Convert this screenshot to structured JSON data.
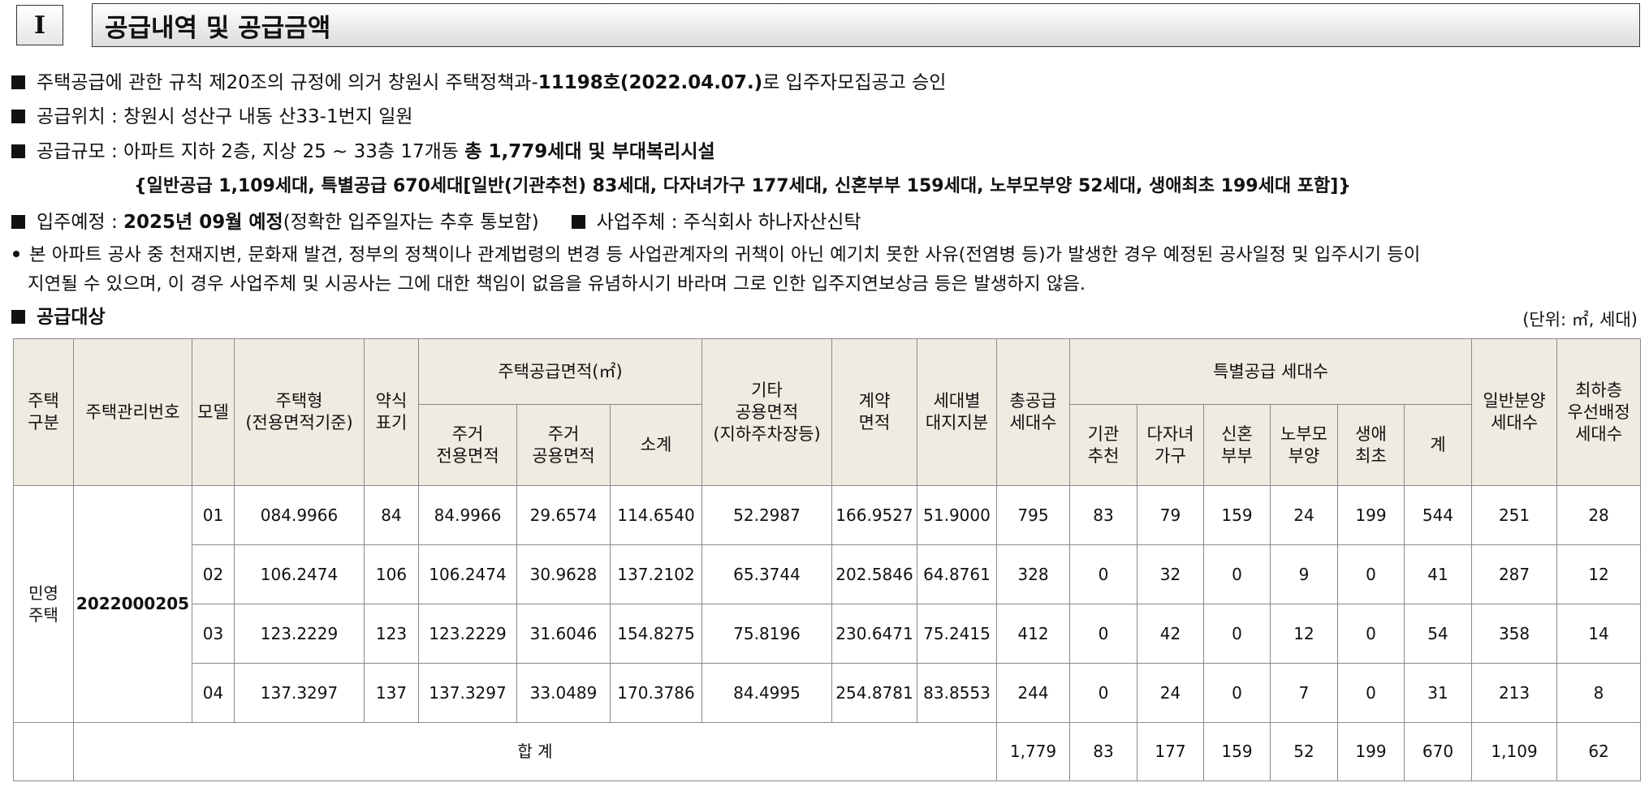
{
  "section": {
    "number": "I",
    "title": "공급내역 및 공급금액"
  },
  "notices": {
    "line1_a": "주택공급에 관한 규칙 제20조의 규정에 의거 창원시 주택정책과-",
    "line1_b": "11198호(2022.04.07.)",
    "line1_c": "로 입주자모집공고 승인",
    "line2": "공급위치 : 창원시 성산구 내동 산33-1번지 일원",
    "line3_a": "공급규모 : 아파트 지하 2층, 지상 25 ~ 33층 17개동 ",
    "line3_b": "총 1,779세대 및 부대복리시설",
    "line4": "{일반공급 1,109세대, 특별공급 670세대[일반(기관추천) 83세대, 다자녀가구 177세대, 신혼부부 159세대, 노부모부양 52세대, 생애최초 199세대 포함]}",
    "line5_a": "입주예정 : ",
    "line5_b": "2025년 09월 예정",
    "line5_c": "(정확한 입주일자는 추후 통보함)",
    "line5_d": "사업주체 : 주식회사 하나자산신탁",
    "line6": "본 아파트 공사 중 천재지변, 문화재 발견, 정부의 정책이나 관계법령의 변경 등 사업관계자의 귀책이 아닌 예기치 못한 사유(전염병 등)가 발생한 경우 예정된 공사일정 및 입주시기 등이",
    "line7": "지연될 수 있으며, 이 경우 사업주체 및 시공사는 그에 대한 책임이 없음을 유념하시기 바라며 그로 인한 입주지연보상금 등은 발생하지 않음."
  },
  "subsection": {
    "title": "공급대상",
    "unit": "(단위: ㎡, 세대)"
  },
  "table": {
    "headers": {
      "housing_type": "주택\n구분",
      "mgmt_no": "주택관리번호",
      "model": "모델",
      "house_type": "주택형\n(전용면적기준)",
      "abbr": "약식\n표기",
      "supply_area": "주택공급면적(㎡)",
      "exclusive": "주거\n전용면적",
      "common": "주거\n공용면적",
      "subtotal": "소계",
      "other_common": "기타\n공용면적\n(지하주차장등)",
      "contract": "계약\n면적",
      "land": "세대별\n대지지분",
      "total_supply": "총공급\n세대수",
      "special": "특별공급 세대수",
      "inst": "기관\n추천",
      "multi": "다자녀\n가구",
      "newlywed": "신혼\n부부",
      "elderly": "노부모\n부양",
      "first": "생애\n최초",
      "sum": "계",
      "general": "일반분양\n세대수",
      "lowest": "최하층\n우선배정\n세대수"
    },
    "housing_type_value": "민영\n주택",
    "mgmt_no_value": "2022000205",
    "rows": [
      {
        "model": "01",
        "type": "084.9966",
        "abbr": "84",
        "exclusive": "84.9966",
        "common": "29.6574",
        "subtotal": "114.6540",
        "other": "52.2987",
        "contract": "166.9527",
        "land": "51.9000",
        "total": "795",
        "inst": "83",
        "multi": "79",
        "newlywed": "159",
        "elderly": "24",
        "first": "199",
        "sum": "544",
        "general": "251",
        "lowest": "28"
      },
      {
        "model": "02",
        "type": "106.2474",
        "abbr": "106",
        "exclusive": "106.2474",
        "common": "30.9628",
        "subtotal": "137.2102",
        "other": "65.3744",
        "contract": "202.5846",
        "land": "64.8761",
        "total": "328",
        "inst": "0",
        "multi": "32",
        "newlywed": "0",
        "elderly": "9",
        "first": "0",
        "sum": "41",
        "general": "287",
        "lowest": "12"
      },
      {
        "model": "03",
        "type": "123.2229",
        "abbr": "123",
        "exclusive": "123.2229",
        "common": "31.6046",
        "subtotal": "154.8275",
        "other": "75.8196",
        "contract": "230.6471",
        "land": "75.2415",
        "total": "412",
        "inst": "0",
        "multi": "42",
        "newlywed": "0",
        "elderly": "12",
        "first": "0",
        "sum": "54",
        "general": "358",
        "lowest": "14"
      },
      {
        "model": "04",
        "type": "137.3297",
        "abbr": "137",
        "exclusive": "137.3297",
        "common": "33.0489",
        "subtotal": "170.3786",
        "other": "84.4995",
        "contract": "254.8781",
        "land": "83.8553",
        "total": "244",
        "inst": "0",
        "multi": "24",
        "newlywed": "0",
        "elderly": "7",
        "first": "0",
        "sum": "31",
        "general": "213",
        "lowest": "8"
      }
    ],
    "total": {
      "label": "합 계",
      "total": "1,779",
      "inst": "83",
      "multi": "177",
      "newlywed": "159",
      "elderly": "52",
      "first": "199",
      "sum": "670",
      "general": "1,109",
      "lowest": "62"
    }
  }
}
